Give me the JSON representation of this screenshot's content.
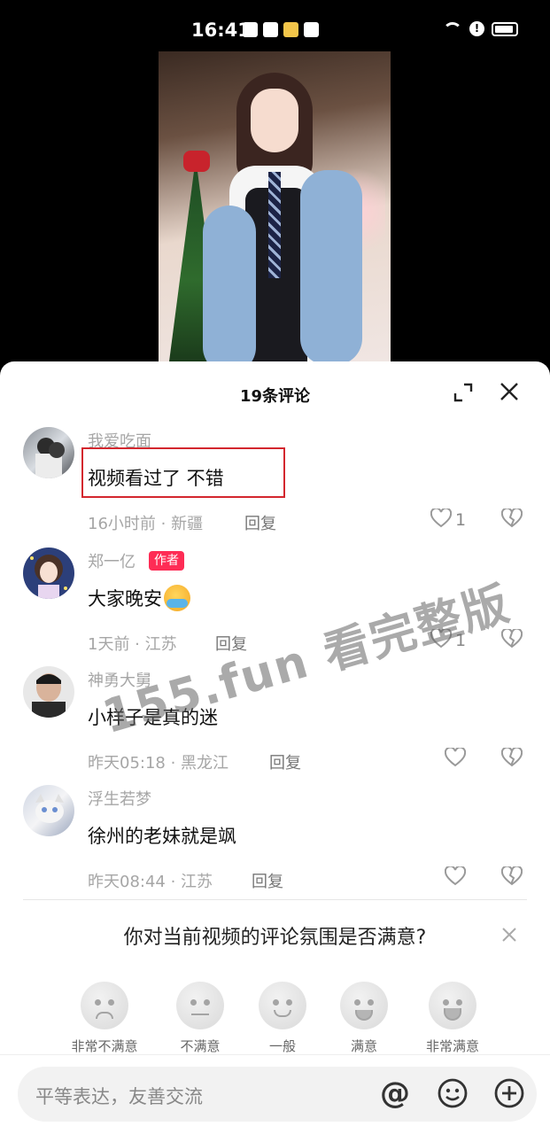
{
  "status_bar": {
    "time": "16:41"
  },
  "video": {
    "description": "video-preview"
  },
  "sheet": {
    "title": "19条评论"
  },
  "comments": [
    {
      "user": "我爱吃面",
      "text": "视频看过了 不错",
      "meta": "16小时前 · 新疆",
      "reply": "回复",
      "likes": "1",
      "author": false
    },
    {
      "user": "郑一亿",
      "badge": "作者",
      "text": "大家晚安",
      "meta": "1天前 · 江苏",
      "reply": "回复",
      "likes": "1",
      "author": true
    },
    {
      "user": "神勇大舅",
      "text": "小样子是真的迷",
      "meta": "昨天05:18 · 黑龙江",
      "reply": "回复",
      "likes": "",
      "author": false
    },
    {
      "user": "浮生若梦",
      "text": "徐州的老妹就是飒",
      "meta": "昨天08:44 · 江苏",
      "reply": "回复",
      "likes": "",
      "author": false
    }
  ],
  "watermark": "155.fun 看完整版",
  "survey": {
    "question": "你对当前视频的评论氛围是否满意?",
    "options": [
      "非常不满意",
      "不满意",
      "一般",
      "满意",
      "非常满意"
    ]
  },
  "input": {
    "placeholder": "平等表达，友善交流"
  },
  "colors": {
    "accent": "#fe2c55",
    "highlight": "#d3272e"
  }
}
